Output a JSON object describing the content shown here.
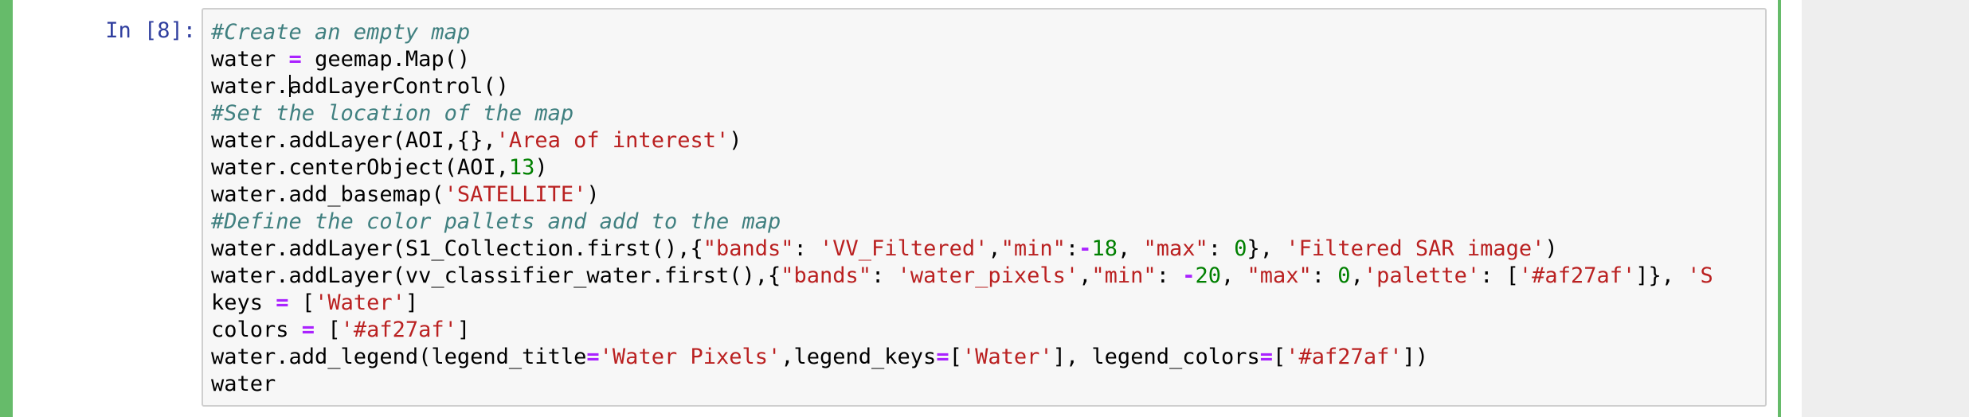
{
  "cell": {
    "prompt": "In [8]:",
    "lines": [
      [
        {
          "c": "cm",
          "t": "#Create an empty map"
        }
      ],
      [
        {
          "c": "",
          "t": "water "
        },
        {
          "c": "op",
          "t": "="
        },
        {
          "c": "",
          "t": " geemap.Map()"
        }
      ],
      [
        {
          "c": "",
          "t": "water."
        },
        {
          "c": "cursor",
          "t": ""
        },
        {
          "c": "",
          "t": "addLayerControl()"
        }
      ],
      [
        {
          "c": "cm",
          "t": "#Set the location of the map"
        }
      ],
      [
        {
          "c": "",
          "t": "water.addLayer(AOI,{},"
        },
        {
          "c": "s",
          "t": "'Area of interest'"
        },
        {
          "c": "",
          "t": ")"
        }
      ],
      [
        {
          "c": "",
          "t": "water.centerObject(AOI,"
        },
        {
          "c": "n",
          "t": "13"
        },
        {
          "c": "",
          "t": ")"
        }
      ],
      [
        {
          "c": "",
          "t": "water.add_basemap("
        },
        {
          "c": "s",
          "t": "'SATELLITE'"
        },
        {
          "c": "",
          "t": ")"
        }
      ],
      [
        {
          "c": "cm",
          "t": "#Define the color pallets and add to the map"
        }
      ],
      [
        {
          "c": "",
          "t": "water.addLayer(S1_Collection.first(),{"
        },
        {
          "c": "s",
          "t": "\"bands\""
        },
        {
          "c": "",
          "t": ": "
        },
        {
          "c": "s",
          "t": "'VV_Filtered'"
        },
        {
          "c": "",
          "t": ","
        },
        {
          "c": "s",
          "t": "\"min\""
        },
        {
          "c": "",
          "t": ":"
        },
        {
          "c": "op",
          "t": "-"
        },
        {
          "c": "n",
          "t": "18"
        },
        {
          "c": "",
          "t": ", "
        },
        {
          "c": "s",
          "t": "\"max\""
        },
        {
          "c": "",
          "t": ": "
        },
        {
          "c": "n",
          "t": "0"
        },
        {
          "c": "",
          "t": "}, "
        },
        {
          "c": "s",
          "t": "'Filtered SAR image'"
        },
        {
          "c": "",
          "t": ")"
        }
      ],
      [
        {
          "c": "",
          "t": "water.addLayer(vv_classifier_water.first(),{"
        },
        {
          "c": "s",
          "t": "\"bands\""
        },
        {
          "c": "",
          "t": ": "
        },
        {
          "c": "s",
          "t": "'water_pixels'"
        },
        {
          "c": "",
          "t": ","
        },
        {
          "c": "s",
          "t": "\"min\""
        },
        {
          "c": "",
          "t": ": "
        },
        {
          "c": "op",
          "t": "-"
        },
        {
          "c": "n",
          "t": "20"
        },
        {
          "c": "",
          "t": ", "
        },
        {
          "c": "s",
          "t": "\"max\""
        },
        {
          "c": "",
          "t": ": "
        },
        {
          "c": "n",
          "t": "0"
        },
        {
          "c": "",
          "t": ","
        },
        {
          "c": "s",
          "t": "'palette'"
        },
        {
          "c": "",
          "t": ": ["
        },
        {
          "c": "s",
          "t": "'#af27af'"
        },
        {
          "c": "",
          "t": "]}, "
        },
        {
          "c": "s",
          "t": "'S"
        }
      ],
      [
        {
          "c": "",
          "t": "keys "
        },
        {
          "c": "op",
          "t": "="
        },
        {
          "c": "",
          "t": " ["
        },
        {
          "c": "s",
          "t": "'Water'"
        },
        {
          "c": "",
          "t": "]"
        }
      ],
      [
        {
          "c": "",
          "t": "colors "
        },
        {
          "c": "op",
          "t": "="
        },
        {
          "c": "",
          "t": " ["
        },
        {
          "c": "s",
          "t": "'#af27af'"
        },
        {
          "c": "",
          "t": "]"
        }
      ],
      [
        {
          "c": "",
          "t": "water.add_legend(legend_title"
        },
        {
          "c": "op",
          "t": "="
        },
        {
          "c": "s",
          "t": "'Water Pixels'"
        },
        {
          "c": "",
          "t": ",legend_keys"
        },
        {
          "c": "op",
          "t": "="
        },
        {
          "c": "",
          "t": "["
        },
        {
          "c": "s",
          "t": "'Water'"
        },
        {
          "c": "",
          "t": "], legend_colors"
        },
        {
          "c": "op",
          "t": "="
        },
        {
          "c": "",
          "t": "["
        },
        {
          "c": "s",
          "t": "'#af27af'"
        },
        {
          "c": "",
          "t": "])"
        }
      ],
      [
        {
          "c": "",
          "t": "water"
        }
      ]
    ]
  },
  "colors": {
    "selected_cell_border": "#66bb6a",
    "prompt": "#303f9f",
    "comment": "#408080",
    "operator": "#aa22ff",
    "string": "#ba2121",
    "number": "#008000",
    "input_background": "#f7f7f7"
  }
}
